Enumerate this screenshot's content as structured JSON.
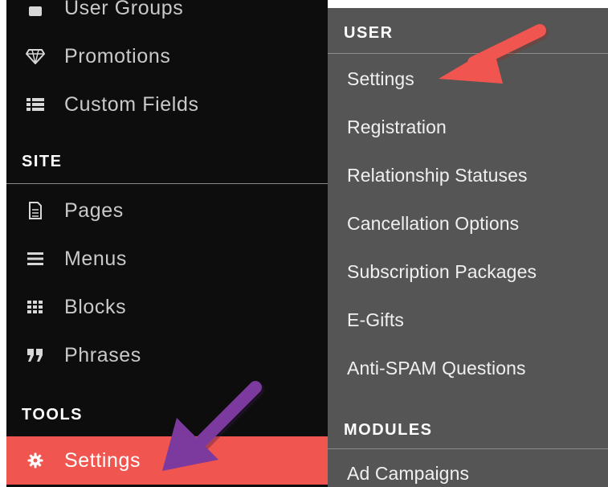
{
  "left_menu": {
    "items_top": [
      {
        "label": "User Groups",
        "icon": "users-icon"
      },
      {
        "label": "Promotions",
        "icon": "diamond-icon"
      },
      {
        "label": "Custom Fields",
        "icon": "list-icon"
      }
    ],
    "site_header": "SITE",
    "site_items": [
      {
        "label": "Pages",
        "icon": "page-icon"
      },
      {
        "label": "Menus",
        "icon": "menu-icon"
      },
      {
        "label": "Blocks",
        "icon": "grid-icon"
      },
      {
        "label": "Phrases",
        "icon": "quote-icon"
      }
    ],
    "tools_header": "TOOLS",
    "tools_items": [
      {
        "label": "Settings",
        "icon": "gear-icon",
        "active": true
      }
    ]
  },
  "submenu": {
    "user_header": "USER",
    "user_items": [
      "Settings",
      "Registration",
      "Relationship Statuses",
      "Cancellation Options",
      "Subscription Packages",
      "E-Gifts",
      "Anti-SPAM Questions"
    ],
    "modules_header": "MODULES",
    "modules_items": [
      "Ad Campaigns"
    ]
  },
  "colors": {
    "sidebar_bg": "#0d0d0d",
    "submenu_bg": "#555555",
    "active_bg": "#f0564f",
    "annotation_orange": "#f0564f",
    "annotation_purple": "#7d3a9e"
  }
}
